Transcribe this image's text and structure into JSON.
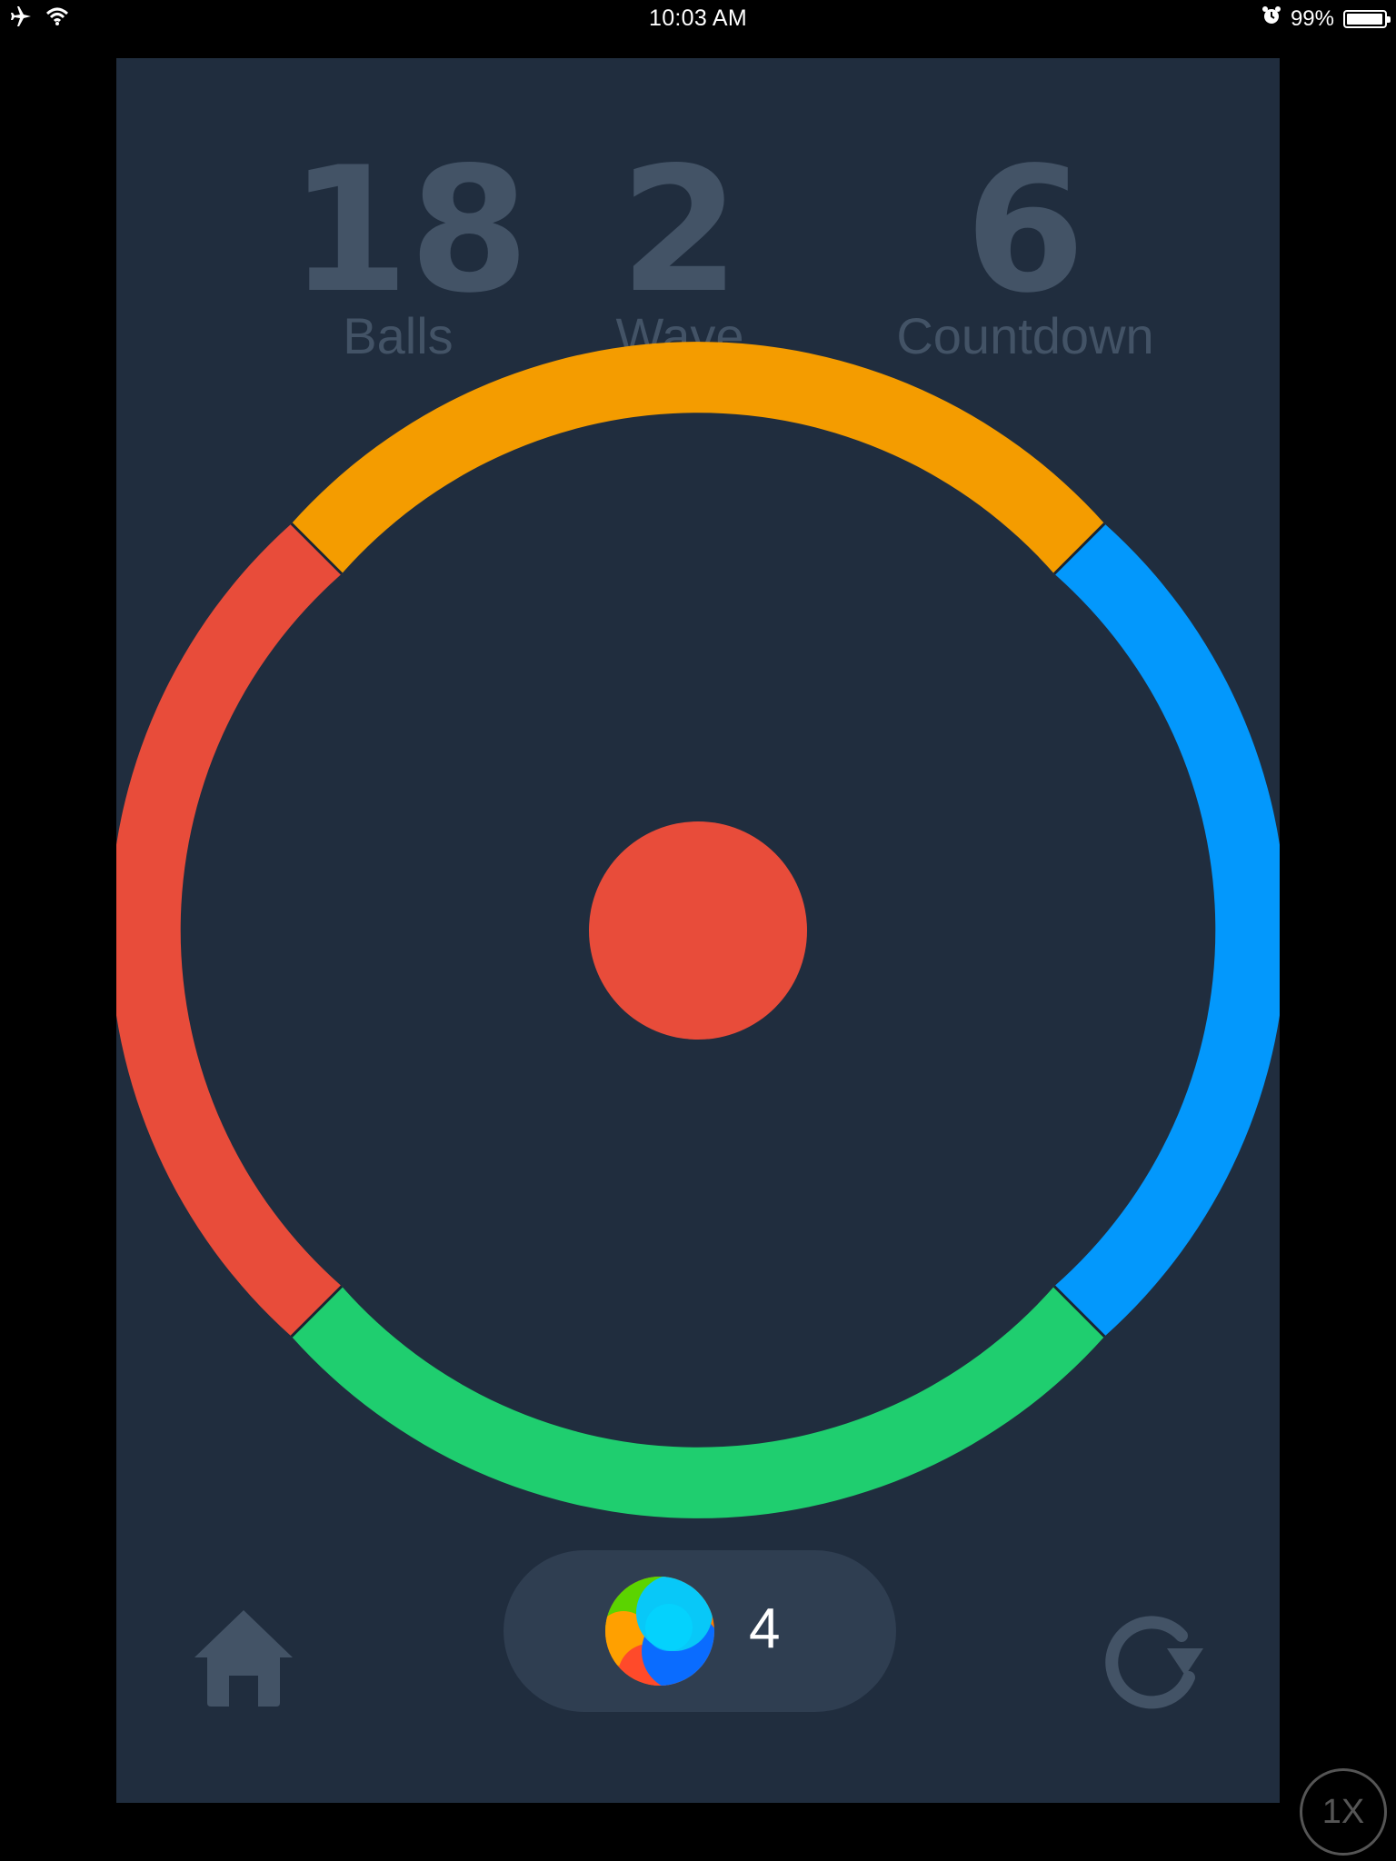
{
  "status_bar": {
    "time": "10:03 AM",
    "battery_percent": "99%",
    "icons": [
      "airplane-icon",
      "wifi-icon",
      "alarm-icon",
      "battery-icon"
    ]
  },
  "game": {
    "stats": [
      {
        "value": "18",
        "label": "Balls"
      },
      {
        "value": "2",
        "label": "Wave"
      },
      {
        "value": "6",
        "label": "Countdown"
      }
    ],
    "ring_colors": {
      "top": "#f49c00",
      "right": "#0398fc",
      "bottom": "#1fce6f",
      "left": "#e84c3a"
    },
    "center_ball_color": "#e84c3a",
    "background_color": "#202d3e",
    "powerup": {
      "icon": "color-orb-icon",
      "count": "4"
    },
    "controls": {
      "home": "home-icon",
      "restart": "restart-icon"
    }
  },
  "speed_indicator": "1X"
}
